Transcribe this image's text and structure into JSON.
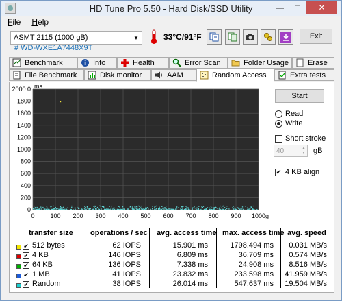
{
  "window": {
    "title": "HD Tune Pro 5.50 - Hard Disk/SSD Utility",
    "minimize": "—",
    "maximize": "□",
    "close": "✕"
  },
  "menu": {
    "items": [
      "File",
      "Help"
    ]
  },
  "toolbar": {
    "drive": "ASMT    2115 (1000 gB)",
    "temperature": "33°C/91°F",
    "exit_label": "Exit",
    "icons": [
      "copy-info-icon",
      "copy-screen-icon",
      "camera-icon",
      "options-icon",
      "download-icon"
    ]
  },
  "serial": "#    WD-WXE1A7448X9T",
  "tabs": {
    "row1": [
      "Benchmark",
      "Info",
      "Health",
      "Error Scan",
      "Folder Usage",
      "Erase"
    ],
    "row2": [
      "File Benchmark",
      "Disk monitor",
      "AAM",
      "Random Access",
      "Extra tests"
    ],
    "active": "Random Access"
  },
  "controls": {
    "start_label": "Start",
    "read_label": "Read",
    "write_label": "Write",
    "mode": "Write",
    "short_stroke_label": "Short stroke",
    "short_stroke_checked": false,
    "short_stroke_value": "40",
    "short_stroke_unit": "gB",
    "align_label": "4 KB align",
    "align_checked": true
  },
  "chart_data": {
    "type": "scatter",
    "ylabel": "ms",
    "xlabel_unit": "gB",
    "y_ticks": [
      "2000.0",
      "1800",
      "1600",
      "1400",
      "1200",
      "1000",
      "800",
      "600",
      "400",
      "200",
      "0"
    ],
    "x_ticks": [
      "0",
      "100",
      "200",
      "300",
      "400",
      "500",
      "600",
      "700",
      "800",
      "900",
      "1000gB"
    ],
    "xlim": [
      0,
      1000
    ],
    "ylim": [
      0,
      2000
    ],
    "grid": true,
    "background": "#2b2b2b",
    "point_color": "#5fd3d3",
    "series": [
      {
        "color": "#f0e040",
        "values_note": "",
        "points": [
          [
            120,
            1800
          ]
        ]
      },
      {
        "color": "#5fd3d3",
        "band": [
          0,
          60
        ],
        "count": 380
      }
    ]
  },
  "results": {
    "headers": [
      "transfer size",
      "operations / sec",
      "avg. access time",
      "max. access time",
      "avg. speed"
    ],
    "rows": [
      {
        "color": "#f2e600",
        "size": "512 bytes",
        "ops": "62 IOPS",
        "avg": "15.901 ms",
        "max": "1798.494 ms",
        "speed": "0.031 MB/s"
      },
      {
        "color": "#e00000",
        "size": "4 KB",
        "ops": "146 IOPS",
        "avg": "6.809 ms",
        "max": "36.709 ms",
        "speed": "0.574 MB/s"
      },
      {
        "color": "#00b000",
        "size": "64 KB",
        "ops": "136 IOPS",
        "avg": "7.338 ms",
        "max": "24.908 ms",
        "speed": "8.516 MB/s"
      },
      {
        "color": "#1e5cd8",
        "size": "1 MB",
        "ops": "41 IOPS",
        "avg": "23.832 ms",
        "max": "233.598 ms",
        "speed": "41.959 MB/s"
      },
      {
        "color": "#1ad0d0",
        "size": "Random",
        "ops": "38 IOPS",
        "avg": "26.014 ms",
        "max": "547.637 ms",
        "speed": "19.504 MB/s"
      }
    ]
  }
}
